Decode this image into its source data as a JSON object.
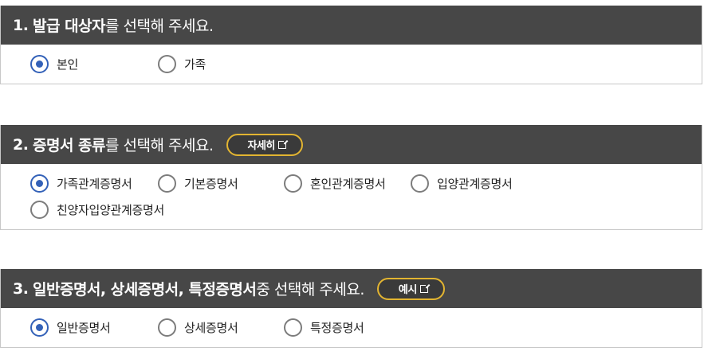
{
  "section1": {
    "number": "1.",
    "title_bold": "발급 대상자",
    "title_rest": "를 선택해 주세요.",
    "options": [
      {
        "label": "본인",
        "selected": true
      },
      {
        "label": "가족",
        "selected": false
      }
    ]
  },
  "section2": {
    "number": "2.",
    "title_bold": "증명서 종류",
    "title_rest": "를 선택해 주세요.",
    "button_label": "자세히",
    "button_icon": "external-link-icon",
    "options": [
      {
        "label": "가족관계증명서",
        "selected": true
      },
      {
        "label": "기본증명서",
        "selected": false
      },
      {
        "label": "혼인관계증명서",
        "selected": false
      },
      {
        "label": "입양관계증명서",
        "selected": false
      },
      {
        "label": "친양자입양관계증명서",
        "selected": false
      }
    ]
  },
  "section3": {
    "number": "3.",
    "title_bold": "일반증명서, 상세증명서, 특정증명서",
    "title_rest": " 중 선택해 주세요.",
    "button_label": "예시",
    "button_icon": "external-link-icon",
    "options": [
      {
        "label": "일반증명서",
        "selected": true
      },
      {
        "label": "상세증명서",
        "selected": false
      },
      {
        "label": "특정증명서",
        "selected": false
      }
    ]
  },
  "colors": {
    "header_bg": "#474747",
    "radio_selected": "#3361b8",
    "button_border": "#e3b531"
  }
}
